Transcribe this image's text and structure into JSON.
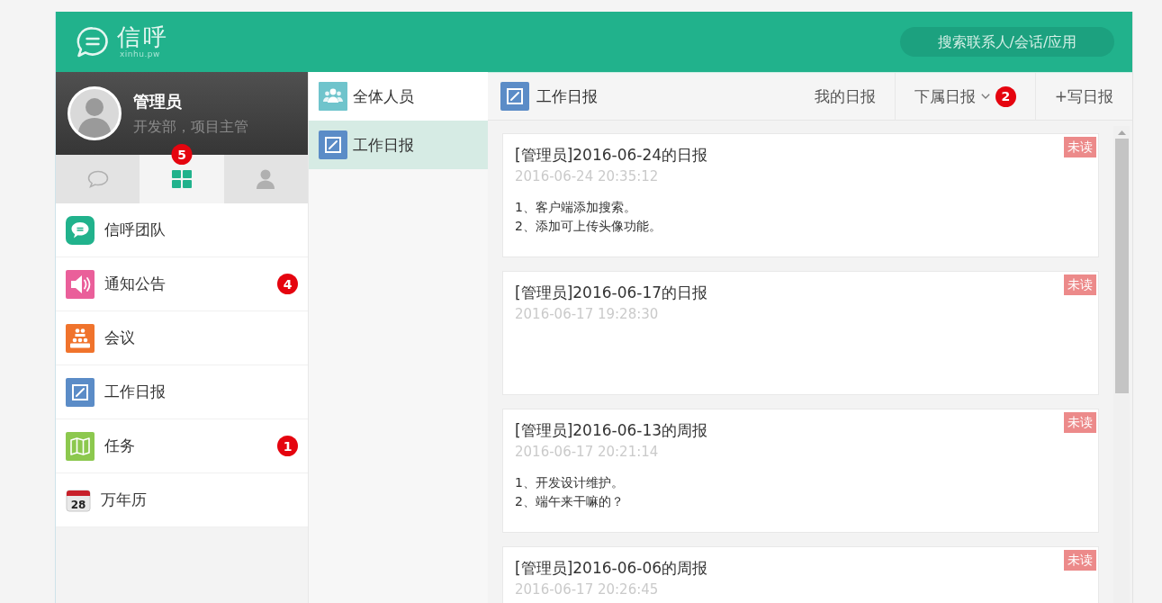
{
  "header": {
    "logo": "信呼",
    "logo_subtitle": "xinhu.pw",
    "search": {
      "placeholder": "搜索联系人/会话/应用"
    }
  },
  "profile": {
    "name": "管理员",
    "subtitle": "开发部，项目主管"
  },
  "sidebar_tabs": [
    {
      "kind": "chat",
      "selected": false
    },
    {
      "kind": "apps",
      "selected": true,
      "badge": "5"
    },
    {
      "kind": "contacts",
      "selected": false
    }
  ],
  "sidebar": {
    "items": [
      {
        "kind": "team",
        "label": "信呼团队"
      },
      {
        "kind": "notice",
        "label": "通知公告",
        "badge": "4"
      },
      {
        "kind": "meeting",
        "label": "会议"
      },
      {
        "kind": "report",
        "label": "工作日报"
      },
      {
        "kind": "task",
        "label": "任务",
        "badge": "1"
      },
      {
        "kind": "calendar",
        "label": "万年历",
        "icon_text": "28"
      }
    ]
  },
  "categories": {
    "items": [
      {
        "kind": "people",
        "label": "全体人员",
        "selected": false
      },
      {
        "kind": "report",
        "label": "工作日报",
        "selected": true
      }
    ]
  },
  "toolbar": {
    "title": "工作日报",
    "actions": [
      {
        "kind": "link",
        "label": "我的日报"
      },
      {
        "kind": "dropdown",
        "label": "下属日报",
        "badge": "2"
      },
      {
        "kind": "link",
        "label": "+写日报"
      }
    ]
  },
  "reports": [
    {
      "title": "[管理员]2016-06-24的日报",
      "time": "2016-06-24 20:35:12",
      "lines": [
        "1、客户端添加搜索。",
        "2、添加可上传头像功能。"
      ],
      "badge": "未读"
    },
    {
      "title": "[管理员]2016-06-17的日报",
      "time": "2016-06-17 19:28:30",
      "badge": "未读"
    },
    {
      "title": "[管理员]2016-06-13的周报",
      "time": "2016-06-17 20:21:14",
      "lines": [
        "1、开发设计维护。",
        "2、端午来干嘛的？"
      ],
      "badge": "未读"
    },
    {
      "title": "[管理员]2016-06-06的周报",
      "time": "2016-06-17 20:26:45",
      "badge": "未读"
    }
  ]
}
